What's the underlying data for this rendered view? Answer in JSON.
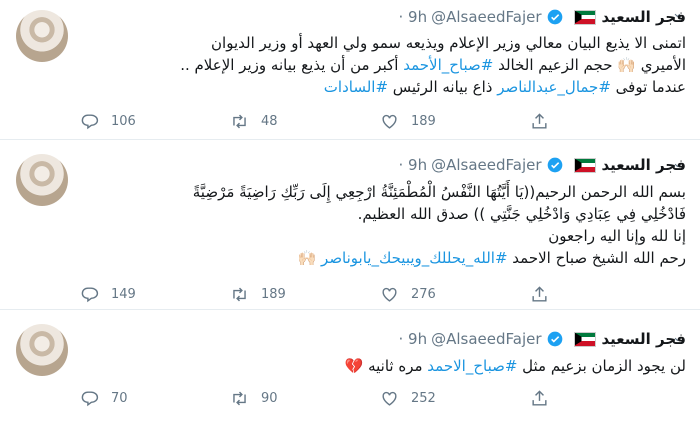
{
  "tweets": [
    {
      "name": "فجر السعيد",
      "handle": "@AlsaeedFajer",
      "time": "· 9h",
      "lines": [
        {
          "parts": [
            {
              "t": "اتمنى الا يذيع البيان معالي وزير الإعلام ويذيعه سمو ولي العهد أو وزير الديوان"
            }
          ]
        },
        {
          "parts": [
            {
              "t": "الأميري 🙌🏻 حجم الزعيم الخالد "
            },
            {
              "t": "#صباح_الأحمد",
              "link": true
            },
            {
              "t": " أكبر من أن يذيع بيانه وزير الإعلام .."
            }
          ]
        },
        {
          "parts": [
            {
              "t": "عندما توفى "
            },
            {
              "t": "#جمال_عبدالناصر",
              "link": true
            },
            {
              "t": " ذاع بيانه الرئيس "
            },
            {
              "t": "#السادات",
              "link": true
            }
          ]
        }
      ],
      "replies": "106",
      "retweets": "48",
      "likes": "189"
    },
    {
      "name": "فجر السعيد",
      "handle": "@AlsaeedFajer",
      "time": "· 9h",
      "lines": [
        {
          "parts": [
            {
              "t": "بسم الله الرحمن الرحيم((يَا أَيَّتُهَا النَّفْسُ الْمُطْمَئِنَّةُ ارْجِعِي إِلَى رَبِّكِ رَاضِيَةً مَرْضِيَّةً"
            }
          ]
        },
        {
          "parts": [
            {
              "t": "فَادْخُلِي فِي عِبَادِي وَادْخُلِي جَنَّتِي )) صدق الله العظيم."
            }
          ]
        },
        {
          "parts": [
            {
              "t": "إنا لله وإنا اليه راجعون"
            }
          ]
        },
        {
          "parts": [
            {
              "t": "رحم الله الشيخ صباح الاحمد "
            },
            {
              "t": "#الله_يحللك_ويبيحك_يابوناصر",
              "link": true
            },
            {
              "t": " 🙌🏻"
            }
          ]
        }
      ],
      "replies": "149",
      "retweets": "189",
      "likes": "276"
    },
    {
      "name": "فجر السعيد",
      "handle": "@AlsaeedFajer",
      "time": "· 9h",
      "lines": [
        {
          "parts": [
            {
              "t": "لن يجود الزمان بزعيم مثل "
            },
            {
              "t": "#صباح_الاحمد",
              "link": true
            },
            {
              "t": " مره ثانيه 💔"
            }
          ]
        }
      ],
      "replies": "70",
      "retweets": "90",
      "likes": "252"
    }
  ],
  "colors": {
    "link": "#1b95e0",
    "muted": "#657786",
    "verified": "#1da1f2"
  },
  "icons": {
    "reply": "reply-icon",
    "retweet": "retweet-icon",
    "like": "heart-icon",
    "share": "share-icon",
    "verified": "verified-badge-icon",
    "menu": "chevron-down-icon",
    "flag": "kuwait-flag-icon"
  }
}
